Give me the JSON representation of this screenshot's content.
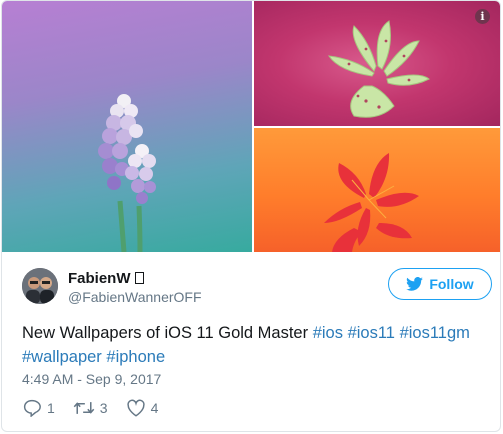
{
  "media": {
    "info_label": "i"
  },
  "author": {
    "display_name": "FabienW",
    "handle": "@FabienWannerOFF"
  },
  "follow": {
    "label": "Follow"
  },
  "tweet": {
    "text_plain": "New Wallpapers of iOS 11 Gold Master",
    "hashtags": [
      "#ios",
      "#ios11",
      "#ios11gm",
      "#wallpaper",
      "#iphone"
    ]
  },
  "meta": {
    "timestamp": "4:49 AM - Sep 9, 2017"
  },
  "actions": {
    "reply_count": "1",
    "retweet_count": "3",
    "like_count": "4"
  },
  "colors": {
    "accent": "#1da1f2",
    "hashtag": "#2b7bb9",
    "secondary_text": "#657786"
  },
  "icons": [
    "info-icon",
    "bird-icon",
    "reply-icon",
    "retweet-icon",
    "heart-icon",
    "verified-icon"
  ]
}
